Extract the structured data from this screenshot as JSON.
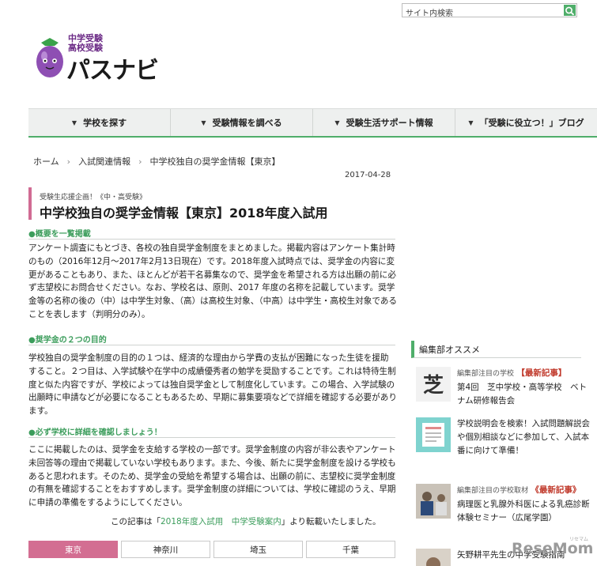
{
  "search": {
    "placeholder": "サイト内検索"
  },
  "logo": {
    "line1": "中学受験",
    "line2": "高校受験",
    "line3": "パスナビ"
  },
  "nav": [
    "学校を探す",
    "受験情報を調べる",
    "受験生活サポート情報",
    "「受験に役立つ！」ブログ"
  ],
  "breadcrumb": [
    "ホーム",
    "入試関連情報",
    "中学校独自の奨学金情報【東京】"
  ],
  "date": "2017-04-28",
  "article": {
    "kicker": "受験生応援企画！《中・高受験》",
    "title": "中学校独自の奨学金情報【東京】2018年度入試用",
    "sec1": "●概要を一覧掲載",
    "p1": "アンケート調査にもとづき、各校の独自奨学金制度をまとめました。掲載内容はアンケート集計時のもの（2016年12月～2017年2月13日現在）です。2018年度入試時点では、奨学金の内容に変更があることもあり、また、ほとんどが若干名募集なので、奨学金を希望される方は出願の前に必ず志望校にお問合せください。なお、学校名は、原則、2017 年度の名称を記載しています。奨学金等の名称の後の（中）は中学生対象、（高）は高校生対象、（中高）は中学生・高校生対象であることを表します（判明分のみ）。",
    "sec2": "●奨学金の２つの目的",
    "p2": "学校独自の奨学金制度の目的の１つは、経済的な理由から学費の支払が困難になった生徒を援助すること。２つ目は、入学試験や在学中の成績優秀者の勉学を奨励することです。これは特待生制度と似た内容ですが、学校によっては独自奨学金として制度化しています。この場合、入学試験の出願時に申請などが必要になることもあるため、早期に募集要項などで詳細を確認する必要があります。",
    "sec3": "●必ず学校に詳細を確認しましょう！",
    "p3": "ここに掲載したのは、奨学金を支給する学校の一部です。奨学金制度の内容が非公表やアンケート未回答等の理由で掲載していない学校もあります。また、今後、新たに奨学金制度を設ける学校もあると思われます。そのため、奨学金の受給を希望する場合は、出願の前に、志望校に奨学金制度の有無を確認することをおすすめします。奨学金制度の詳細については、学校に確認のうえ、早期に申請の準備をするようにしてください。",
    "credit_pre": "この記事は「",
    "credit_link": "2018年度入試用　中学受験案内",
    "credit_post": "」より転載いたしました。"
  },
  "pref_tabs": [
    "東京",
    "神奈川",
    "埼玉",
    "千葉"
  ],
  "sidebar": {
    "heading": "編集部オススメ",
    "items": [
      {
        "label": "編集部注目の学校",
        "badge": "【最新記事】",
        "text": "第4回　芝中学校・高等学校　ベトナム研修報告会"
      },
      {
        "text": "学校説明会を検索！入試問題解説会や個別相談などに参加して、入試本番に向けて準備！"
      },
      {
        "label": "編集部注目の学校取材",
        "badge": "《最新記事》",
        "text": "病理医と乳腺外科医による乳癌診断体験セミナー（広尾学園）"
      },
      {
        "label": "矢野耕平先生の中学受験指南"
      }
    ]
  },
  "watermark": "ReseMom",
  "watermark_sub": "リセマム",
  "colors": {
    "accent": "#4fae6a",
    "pink": "#d36e92",
    "link": "#3c9d5c"
  }
}
